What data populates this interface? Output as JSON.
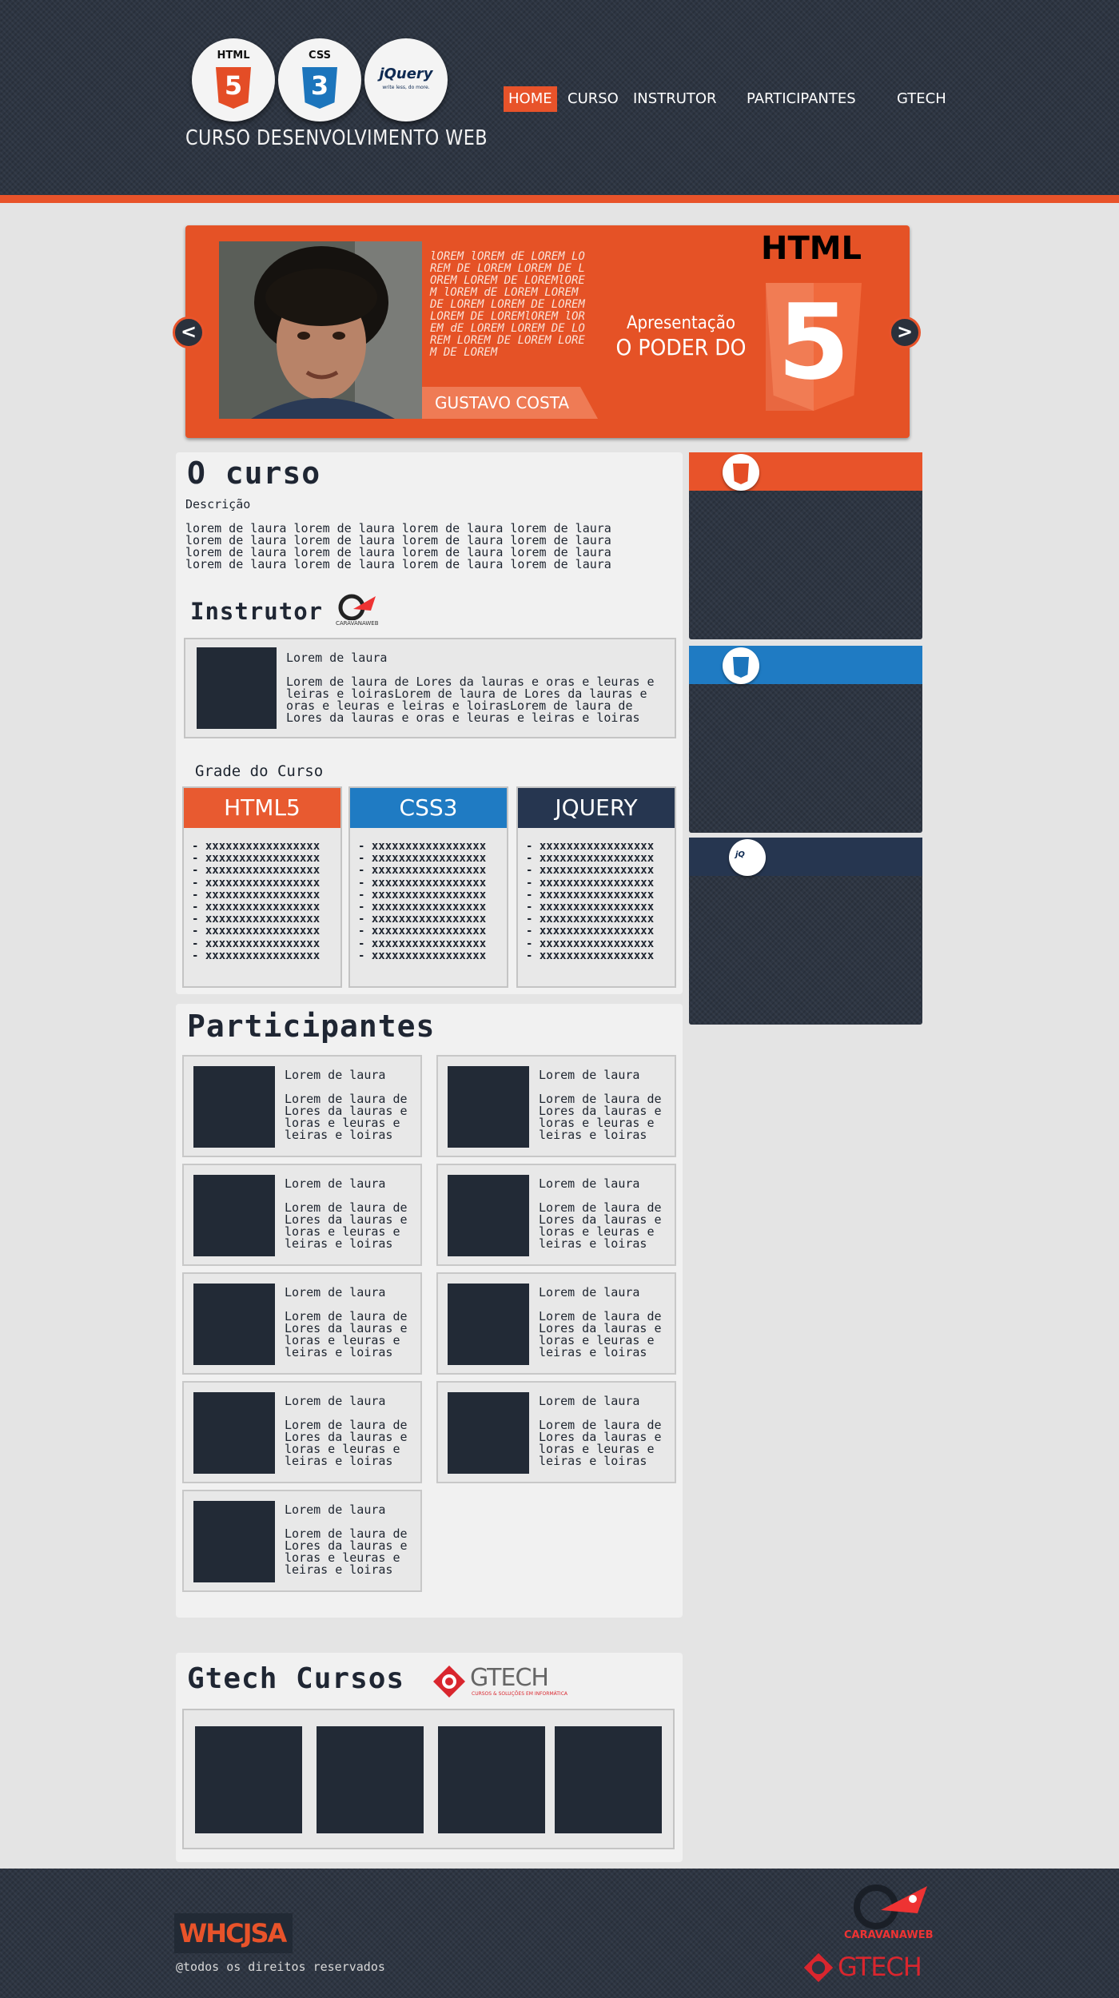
{
  "header": {
    "logos": [
      {
        "label": "HTML",
        "glyph": "5",
        "color": "#e44d26"
      },
      {
        "label": "CSS",
        "glyph": "3",
        "color": "#1c75bc"
      },
      {
        "label": "jQuery",
        "sub": "write less, do more."
      }
    ],
    "site_title": "CURSO DESENVOLVIMENTO WEB",
    "nav": [
      "HOME",
      "CURSO",
      "INSTRUTOR",
      "PARTICIPANTES",
      "GTECH"
    ],
    "active_nav": "HOME"
  },
  "slider": {
    "text": "lOREM lOREM dE LOREM LOREM DE LOREM LOREM DE LOREM LOREM DE LOREMlOREM lOREM dE LOREM LOREM DE LOREM LOREM DE LOREM LOREM DE LOREMlOREM lOREM dE LOREM LOREM DE LOREM LOREM DE LOREM LOREM DE LOREM",
    "name": "GUSTAVO COSTA",
    "heading1": "Apresentação",
    "heading2": "O PODER DO",
    "badge_title": "HTML",
    "badge_glyph": "5",
    "prev": "<",
    "next": ">"
  },
  "curso": {
    "title": "O curso",
    "desc_label": "Descrição",
    "desc_lines": [
      "lorem de laura lorem de laura lorem de laura lorem de laura",
      "lorem de laura lorem de laura lorem de laura lorem de laura",
      "lorem de laura lorem de laura lorem de laura lorem de laura",
      "lorem de laura lorem de laura lorem de laura lorem de laura"
    ],
    "instrutor_title": "Instrutor",
    "instrutor_logo": "CARAVANAWEB",
    "instrutor_name": "Lorem de laura",
    "instrutor_text": "Lorem de laura de Lores da lauras e oras e leuras e leiras e loirasLorem de laura de Lores da lauras e oras e leuras e leiras e loirasLorem de laura de Lores da lauras e oras e leuras e leiras e loiras",
    "grade_title": "Grade do Curso",
    "columns": [
      {
        "name": "HTML5",
        "color": "#e85a30"
      },
      {
        "name": "CSS3",
        "color": "#1f7bc3"
      },
      {
        "name": "JQUERY",
        "color": "#263650"
      }
    ],
    "grade_item": "- xxxxxxxxxxxxxxxxx"
  },
  "sidebar": [
    {
      "icon": "html5-icon",
      "color": "#e8532a"
    },
    {
      "icon": "css3-icon",
      "color": "#1f7bc3"
    },
    {
      "icon": "jquery-icon",
      "color": "#263650"
    }
  ],
  "participantes": {
    "title": "Participantes",
    "card_title": "Lorem de laura",
    "card_text": "Lorem de laura de Lores da lauras e loras e leuras e leiras e loiras"
  },
  "gtech": {
    "title": "Gtech Cursos",
    "logo_text": "GTECH",
    "logo_sub": "CURSOS & SOLUÇÕES EM INFORMÁTICA"
  },
  "footer": {
    "brand": "WHCJSA",
    "copyright": "@todos os direitos reservados",
    "logo1": "CARAVANAWEB",
    "logo2": "GTECH"
  }
}
